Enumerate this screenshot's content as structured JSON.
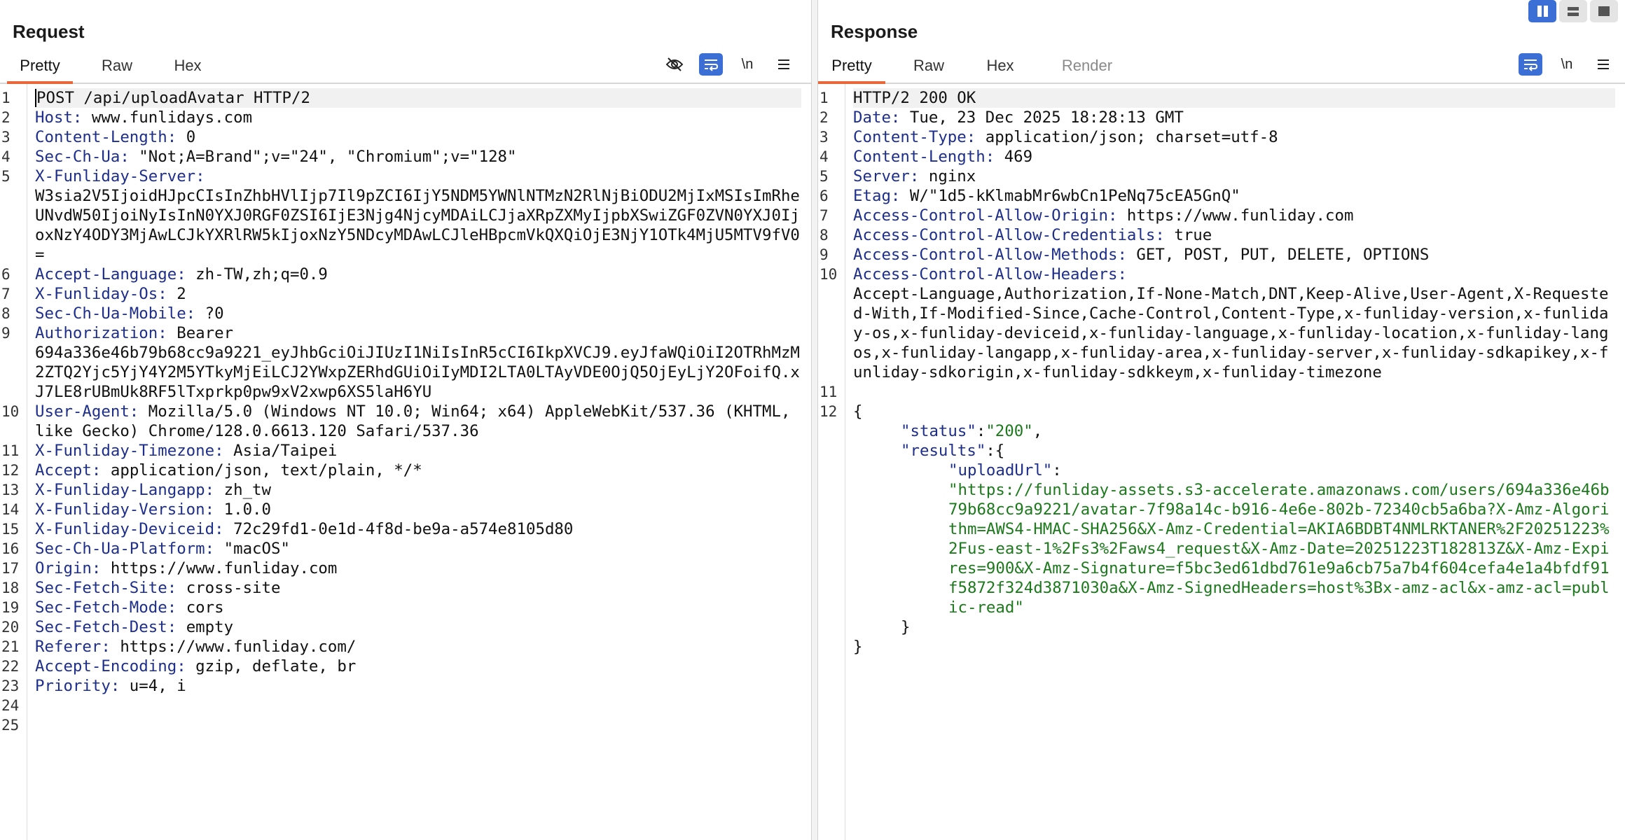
{
  "request": {
    "title": "Request",
    "tabs": [
      "Pretty",
      "Raw",
      "Hex"
    ],
    "toolbar": [
      "eye-slash-icon",
      "wrap-icon",
      "\\n",
      "menu-icon"
    ],
    "lines": [
      {
        "n": "1",
        "name": "",
        "value": "POST /api/uploadAvatar HTTP/2"
      },
      {
        "n": "2",
        "name": "Host",
        "value": " www.funlidays.com"
      },
      {
        "n": "3",
        "name": "Content-Length",
        "value": " 0"
      },
      {
        "n": "4",
        "name": "Sec-Ch-Ua",
        "value": " \"Not;A=Brand\";v=\"24\", \"Chromium\";v=\"128\""
      },
      {
        "n": "5",
        "name": "X-Funliday-Server",
        "value": "\nW3sia2V5IjoidHJpcCIsInZhbHVlIjp7Il9pZCI6IjY5NDM5YWNlNTMzN2RlNjBiODU2MjIxMSIsImRheUNvdW50IjoiNyIsInN0YXJ0RGF0ZSI6IjE3Njg4NjcyMDAiLCJjaXRpZXMyIjpbXSwiZGF0ZVN0YXJ0IjoxNzY4ODY3MjAwLCJkYXRlRW5kIjoxNzY5NDcyMDAwLCJleHBpcmVkQXQiOjE3NjY1OTk4MjU5MTV9fV0="
      },
      {
        "n": "6",
        "name": "Accept-Language",
        "value": " zh-TW,zh;q=0.9"
      },
      {
        "n": "7",
        "name": "X-Funliday-Os",
        "value": " 2"
      },
      {
        "n": "8",
        "name": "Sec-Ch-Ua-Mobile",
        "value": " ?0"
      },
      {
        "n": "9",
        "name": "Authorization",
        "value": " Bearer\n694a336e46b79b68cc9a9221_eyJhbGciOiJIUzI1NiIsInR5cCI6IkpXVCJ9.eyJfaWQiOiI2OTRhMzM2ZTQ2Yjc5YjY4Y2M5YTkyMjEiLCJ2YWxpZERhdGUiOiIyMDI2LTA0LTAyVDE0OjQ5OjEyLjY2OFoifQ.xJ7LE8rUBmUk8RF5lTxprkp0pw9xV2xwp6XS5laH6YU"
      },
      {
        "n": "10",
        "name": "User-Agent",
        "value": " Mozilla/5.0 (Windows NT 10.0; Win64; x64) AppleWebKit/537.36 (KHTML, like Gecko) Chrome/128.0.6613.120 Safari/537.36"
      },
      {
        "n": "11",
        "name": "X-Funliday-Timezone",
        "value": " Asia/Taipei"
      },
      {
        "n": "12",
        "name": "Accept",
        "value": " application/json, text/plain, */*"
      },
      {
        "n": "13",
        "name": "X-Funliday-Langapp",
        "value": " zh_tw"
      },
      {
        "n": "14",
        "name": "X-Funliday-Version",
        "value": " 1.0.0"
      },
      {
        "n": "15",
        "name": "X-Funliday-Deviceid",
        "value": " 72c29fd1-0e1d-4f8d-be9a-a574e8105d80"
      },
      {
        "n": "16",
        "name": "Sec-Ch-Ua-Platform",
        "value": " \"macOS\""
      },
      {
        "n": "17",
        "name": "Origin",
        "value": " https://www.funliday.com"
      },
      {
        "n": "18",
        "name": "Sec-Fetch-Site",
        "value": " cross-site"
      },
      {
        "n": "19",
        "name": "Sec-Fetch-Mode",
        "value": " cors"
      },
      {
        "n": "20",
        "name": "Sec-Fetch-Dest",
        "value": " empty"
      },
      {
        "n": "21",
        "name": "Referer",
        "value": " https://www.funliday.com/"
      },
      {
        "n": "22",
        "name": "Accept-Encoding",
        "value": " gzip, deflate, br"
      },
      {
        "n": "23",
        "name": "Priority",
        "value": " u=4, i"
      },
      {
        "n": "24",
        "name": "",
        "value": ""
      },
      {
        "n": "25",
        "name": "",
        "value": ""
      }
    ]
  },
  "response": {
    "title": "Response",
    "tabs": [
      "Pretty",
      "Raw",
      "Hex",
      "Render"
    ],
    "toolbar": [
      "wrap-icon",
      "\\n",
      "menu-icon"
    ],
    "lines": [
      {
        "n": "1",
        "name": "",
        "value": "HTTP/2 200 OK"
      },
      {
        "n": "2",
        "name": "Date",
        "value": " Tue, 23 Dec 2025 18:28:13 GMT"
      },
      {
        "n": "3",
        "name": "Content-Type",
        "value": " application/json; charset=utf-8"
      },
      {
        "n": "4",
        "name": "Content-Length",
        "value": " 469"
      },
      {
        "n": "5",
        "name": "Server",
        "value": " nginx"
      },
      {
        "n": "6",
        "name": "Etag",
        "value": " W/\"1d5-kKlmabMr6wbCn1PeNq75cEA5GnQ\""
      },
      {
        "n": "7",
        "name": "Access-Control-Allow-Origin",
        "value": " https://www.funliday.com"
      },
      {
        "n": "8",
        "name": "Access-Control-Allow-Credentials",
        "value": " true"
      },
      {
        "n": "9",
        "name": "Access-Control-Allow-Methods",
        "value": " GET, POST, PUT, DELETE, OPTIONS"
      },
      {
        "n": "10",
        "name": "Access-Control-Allow-Headers",
        "value": "\nAccept-Language,Authorization,If-None-Match,DNT,Keep-Alive,User-Agent,X-Requested-With,If-Modified-Since,Cache-Control,Content-Type,x-funliday-version,x-funliday-os,x-funliday-deviceid,x-funliday-language,x-funliday-location,x-funliday-langos,x-funliday-langapp,x-funliday-area,x-funliday-server,x-funliday-sdkapikey,x-funliday-sdkorigin,x-funliday-sdkkeym,x-funliday-timezone"
      },
      {
        "n": "11",
        "name": "",
        "value": ""
      }
    ],
    "json": {
      "open_brace": "{",
      "status_key": "\"status\"",
      "status_val": "\"200\"",
      "results_key": "\"results\"",
      "upload_key": "\"uploadUrl\"",
      "upload_val": "\"https://funliday-assets.s3-accelerate.amazonaws.com/users/694a336e46b79b68cc9a9221/avatar-7f98a14c-b916-4e6e-802b-72340cb5a6ba?X-Amz-Algorithm=AWS4-HMAC-SHA256&X-Amz-Credential=AKIA6BDBT4NMLRKTANER%2F20251223%2Fus-east-1%2Fs3%2Faws4_request&X-Amz-Date=20251223T182813Z&X-Amz-Expires=900&X-Amz-Signature=f5bc3ed61dbd761e9a6cb75a7b4f604cefa4e1a4bfdf91f5872f324d3871030a&X-Amz-SignedHeaders=host%3Bx-amz-acl&x-amz-acl=public-read\"",
      "inner_close": "}",
      "outer_close": "}"
    }
  }
}
